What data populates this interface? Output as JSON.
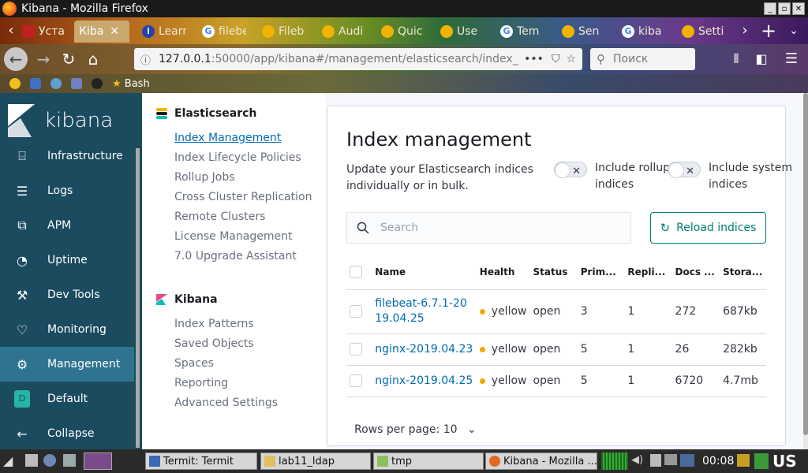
{
  "window": {
    "title": "Kibana - Mozilla Firefox"
  },
  "tabs": [
    {
      "label": "Уста",
      "icon": "red-screen-icon",
      "color": "#c02020"
    },
    {
      "label": "Кiba",
      "icon": "kibana-icon",
      "color": "#e8488b",
      "active": true
    },
    {
      "label": "Learn",
      "icon": "info-icon",
      "color": "#2244aa"
    },
    {
      "label": "filebe",
      "icon": "google-icon",
      "color": "#4285f4"
    },
    {
      "label": "Fileb",
      "icon": "elastic-icon",
      "color": "#f0b400"
    },
    {
      "label": "Audi",
      "icon": "elastic-icon",
      "color": "#f0b400"
    },
    {
      "label": "Quic",
      "icon": "elastic-icon",
      "color": "#f0b400"
    },
    {
      "label": "Use",
      "icon": "elastic-icon",
      "color": "#f0b400"
    },
    {
      "label": "Tem",
      "icon": "google-icon",
      "color": "#4285f4"
    },
    {
      "label": "Sen",
      "icon": "elastic-icon",
      "color": "#f0b400"
    },
    {
      "label": "kiba",
      "icon": "google-icon",
      "color": "#4285f4"
    },
    {
      "label": "Setti",
      "icon": "elastic-icon",
      "color": "#f0b400"
    }
  ],
  "url": {
    "host": "127.0.0.1",
    "rest": ":50000/app/kibana#/management/elasticsearch/index_",
    "more": "•••"
  },
  "search_box": {
    "placeholder": "Поиск"
  },
  "bookmarks": {
    "bash_label": "Bash"
  },
  "sidebar": {
    "brand": "kibana",
    "items": [
      {
        "label": "Infrastructure",
        "icon": "infrastructure-icon"
      },
      {
        "label": "Logs",
        "icon": "logs-icon"
      },
      {
        "label": "APM",
        "icon": "apm-icon"
      },
      {
        "label": "Uptime",
        "icon": "uptime-icon"
      },
      {
        "label": "Dev Tools",
        "icon": "dev-tools-icon"
      },
      {
        "label": "Monitoring",
        "icon": "monitoring-icon"
      },
      {
        "label": "Management",
        "icon": "gear-icon",
        "active": true
      },
      {
        "label": "Default",
        "icon": "space-badge",
        "badge": "D"
      },
      {
        "label": "Collapse",
        "icon": "arrow-left-icon"
      }
    ]
  },
  "subnav": {
    "elasticsearch": {
      "title": "Elasticsearch",
      "links": [
        "Index Management",
        "Index Lifecycle Policies",
        "Rollup Jobs",
        "Cross Cluster Replication",
        "Remote Clusters",
        "License Management",
        "7.0 Upgrade Assistant"
      ]
    },
    "kibana": {
      "title": "Kibana",
      "links": [
        "Index Patterns",
        "Saved Objects",
        "Spaces",
        "Reporting",
        "Advanced Settings"
      ]
    }
  },
  "main": {
    "title": "Index management",
    "description": "Update your Elasticsearch indices individually or in bulk.",
    "toggle_rollup": "Include rollup indices",
    "toggle_system": "Include system indices",
    "search_placeholder": "Search",
    "reload_label": "Reload indices",
    "columns": [
      "Name",
      "Health",
      "Status",
      "Prim...",
      "Repli...",
      "Docs ...",
      "Stora..."
    ],
    "rows": [
      {
        "name": "filebeat-6.7.1-2019.04.25",
        "health": "yellow",
        "status": "open",
        "primaries": "3",
        "replicas": "1",
        "docs": "272",
        "storage": "687kb"
      },
      {
        "name": "nginx-2019.04.23",
        "health": "yellow",
        "status": "open",
        "primaries": "5",
        "replicas": "1",
        "docs": "26",
        "storage": "282kb"
      },
      {
        "name": "nginx-2019.04.25",
        "health": "yellow",
        "status": "open",
        "primaries": "5",
        "replicas": "1",
        "docs": "6720",
        "storage": "4.7mb"
      }
    ],
    "rows_per_page": "Rows per page: 10"
  },
  "taskbar": {
    "buttons": [
      "Termit: Termit",
      "lab11_ldap",
      "tmp",
      "Kibana - Mozilla ..."
    ],
    "clock": "00:08",
    "lang": "US"
  },
  "colors": {
    "kibana_sidebar": "#1b4b5f",
    "link": "#006bb4",
    "accent": "#017d73",
    "health_yellow": "#f5a700"
  }
}
